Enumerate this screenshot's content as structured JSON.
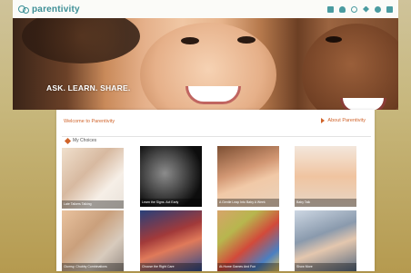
{
  "header": {
    "brand": "parentivity",
    "icons": [
      "home-icon",
      "user-icon",
      "search-icon",
      "star-icon",
      "help-icon",
      "settings-icon"
    ]
  },
  "hero": {
    "tagline": "ASK. LEARN. SHARE."
  },
  "panel": {
    "welcome": "Welcome to Parentivity",
    "about": "About Parentivity",
    "choices_label": "My Choices",
    "tiles": [
      {
        "caption": "Late Talkers Talking"
      },
      {
        "caption": "Learn the Signs. Act Early"
      },
      {
        "caption": "A Gentle Leap Into Baby A Week"
      },
      {
        "caption": "Baby Talk"
      },
      {
        "caption": "Clumsy, Chubby Combinations"
      },
      {
        "caption": "Choose the Right Care"
      },
      {
        "caption": "At-Home Games And Fun"
      },
      {
        "caption": "Show More"
      }
    ]
  },
  "colors": {
    "brand_teal": "#3c8e95",
    "accent_orange": "#d0632a"
  }
}
